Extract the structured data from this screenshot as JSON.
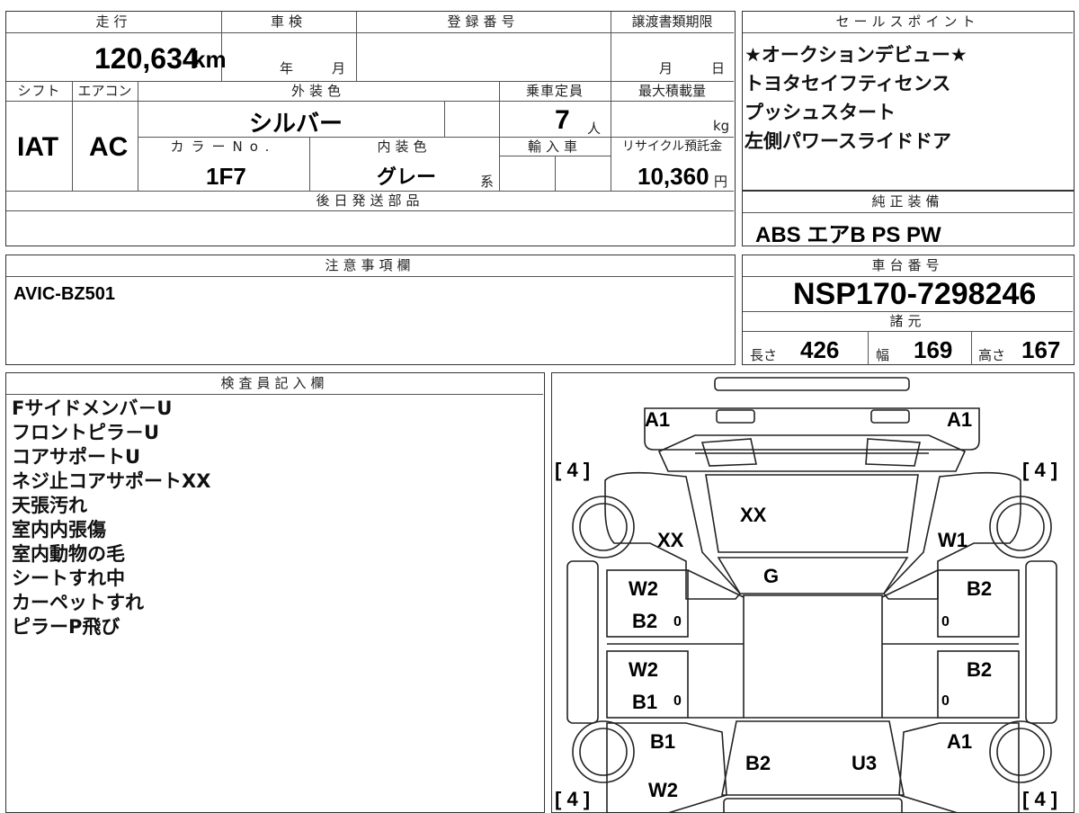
{
  "vehicle": {
    "mileage_label": "走行",
    "mileage_value": "120,634",
    "mileage_unit": "km",
    "inspection_label": "車検",
    "inspection_year": "年",
    "inspection_month": "月",
    "registration_label": "登録番号",
    "transfer_label": "譲渡書類期限",
    "transfer_month": "月",
    "transfer_day": "日",
    "shift_label": "シフト",
    "shift_value": "IAT",
    "ac_label": "エアコン",
    "ac_value": "AC",
    "exterior_label": "外装色",
    "exterior_value": "シルバー",
    "capacity_label": "乗車定員",
    "capacity_value": "7",
    "capacity_unit": "人",
    "load_label": "最大積載量",
    "load_unit": "kg",
    "color_no_label": "カラーNo.",
    "color_no_value": "1F7",
    "interior_label": "内装色",
    "interior_value": "グレー",
    "interior_suffix": "系",
    "import_label": "輸入車",
    "recycle_label": "リサイクル預託金",
    "recycle_value": "10,360",
    "recycle_unit": "円",
    "later_parts_label": "後日発送部品"
  },
  "sales": {
    "label": "セールスポイント",
    "points": [
      "★オークションデビュー★",
      "トヨタセイフティセンス",
      "プッシュスタート",
      "左側パワースライドドア"
    ]
  },
  "equipment": {
    "label": "純正装備",
    "value": "ABS エアB PS PW"
  },
  "notes": {
    "label": "注意事項欄",
    "value": "AVIC-BZ501"
  },
  "chassis": {
    "label": "車台番号",
    "value": "NSP170-7298246",
    "spec_label": "諸元",
    "length_label": "長さ",
    "length_value": "426",
    "width_label": "幅",
    "width_value": "169",
    "height_label": "高さ",
    "height_value": "167"
  },
  "inspector": {
    "label": "検査員記入欄",
    "items": [
      "Fサイドメンバ－U",
      "フロントピラ－U",
      "コアサポートU",
      "ネジ止コアサポートXX",
      "天張汚れ",
      "室内内張傷",
      "室内動物の毛",
      "シートすれ中",
      "カーペットすれ",
      "ピラーP飛び"
    ]
  },
  "diagram": {
    "marks": {
      "front_left": "A1",
      "front_right": "A1",
      "tire_fl": "[ 4 ]",
      "tire_fr": "[ 4 ]",
      "tire_rl": "[ 4 ]",
      "tire_rr": "[ 4 ]",
      "windshield": "XX",
      "fender_left": "XX",
      "fender_right": "W1",
      "roof_front": "G",
      "door_fl_1": "W2",
      "door_fl_2": "B2",
      "door_fl_zero": "0",
      "door_fr_1": "B2",
      "door_fr_zero": "0",
      "door_rl_1": "W2",
      "door_rl_2": "B1",
      "door_rl_zero": "0",
      "door_rr_1": "B2",
      "door_rr_zero": "0",
      "quarter_left": "B1",
      "quarter_right": "A1",
      "rear_left": "B2",
      "rear_right": "U3",
      "rear_bottom": "W2"
    }
  }
}
